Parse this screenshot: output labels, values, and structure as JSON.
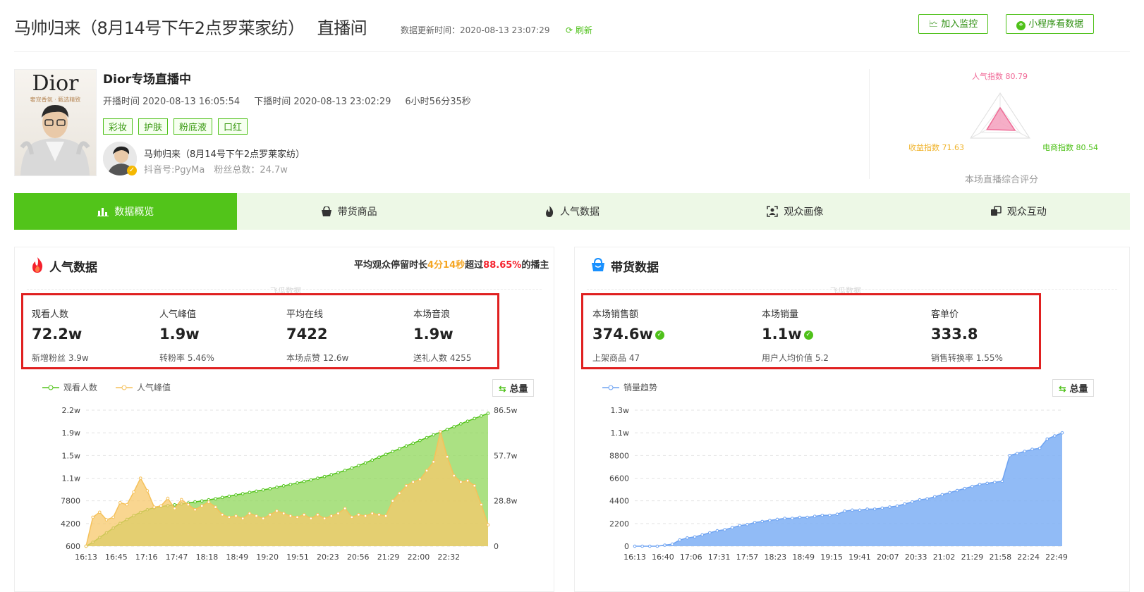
{
  "header": {
    "title": "马帅归来（8月14号下午2点罗莱家纺）",
    "subtitle": "直播间",
    "update_time": "数据更新时间：2020-08-13 23:07:29",
    "refresh": "刷新",
    "monitor_btn": "加入监控",
    "miniapp_btn": "小程序看数据"
  },
  "room": {
    "cover_text": "Dior",
    "cover_tagline": "奢宠香氛 · 甄选精致",
    "title": "Dior专场直播中",
    "start": "开播时间 2020-08-13 16:05:54",
    "end": "下播时间 2020-08-13 23:02:29",
    "duration": "6小时56分35秒",
    "tags": [
      "彩妆",
      "护肤",
      "粉底液",
      "口红"
    ],
    "anchor_name": "马帅归来（8月14号下午2点罗莱家纺）",
    "anchor_meta": "抖音号:PgyMa　粉丝总数：24.7w"
  },
  "radar": {
    "popularity": "人气指数 80.79",
    "revenue": "收益指数 71.63",
    "ecommerce": "电商指数 80.54",
    "caption": "本场直播综合评分",
    "values": [
      80.79,
      80.54,
      71.63
    ]
  },
  "tabs": [
    {
      "label": "数据概览",
      "icon": "bar-chart-icon"
    },
    {
      "label": "带货商品",
      "icon": "shopping-bag-icon"
    },
    {
      "label": "人气数据",
      "icon": "flame-icon"
    },
    {
      "label": "观众画像",
      "icon": "portrait-icon"
    },
    {
      "label": "观众互动",
      "icon": "interaction-icon"
    }
  ],
  "popularity": {
    "title": "人气数据",
    "stay_pre": "平均观众停留时长",
    "stay_time": "4分14秒",
    "stay_mid": "超过",
    "stay_pct": "88.65%",
    "stay_post": "的播主",
    "watermark": "飞瓜数据",
    "metrics": [
      {
        "label": "观看人数",
        "value": "72.2w",
        "sub": "新增粉丝 3.9w"
      },
      {
        "label": "人气峰值",
        "value": "1.9w",
        "sub": "转粉率 5.46%"
      },
      {
        "label": "平均在线",
        "value": "7422",
        "sub": "本场点赞 12.6w"
      },
      {
        "label": "本场音浪",
        "value": "1.9w",
        "sub": "送礼人数 4255"
      }
    ],
    "legend": [
      "观看人数",
      "人气峰值"
    ],
    "total_btn": "总量"
  },
  "sales": {
    "title": "带货数据",
    "watermark": "飞瓜数据",
    "metrics": [
      {
        "label": "本场销售额",
        "value": "374.6w",
        "sub": "上架商品 47",
        "verified": true
      },
      {
        "label": "本场销量",
        "value": "1.1w",
        "sub": "用户人均价值 5.2",
        "verified": true
      },
      {
        "label": "客单价",
        "value": "333.8",
        "sub": "销售转换率 1.55%",
        "verified": false
      }
    ],
    "legend": [
      "销量趋势"
    ],
    "total_btn": "总量"
  },
  "chart_data": [
    {
      "type": "area",
      "x": [
        "16:13",
        "16:45",
        "17:16",
        "17:47",
        "18:18",
        "18:49",
        "19:20",
        "19:51",
        "20:23",
        "20:56",
        "21:29",
        "22:00",
        "22:32"
      ],
      "left_ticks": [
        "600",
        "4200",
        "7800",
        "1.1w",
        "1.5w",
        "1.9w",
        "2.2w"
      ],
      "left_tick_values": [
        600,
        4200,
        7800,
        11400,
        15000,
        18600,
        22200
      ],
      "right_ticks": [
        "0",
        "28.8w",
        "57.7w",
        "86.5w"
      ],
      "right_tick_values": [
        0,
        288000,
        577000,
        865000
      ],
      "series": [
        {
          "name": "观看人数",
          "axis": "right",
          "color": "#52c41a",
          "values": [
            0,
            25000,
            55000,
            85000,
            115000,
            145000,
            170000,
            195000,
            215000,
            232000,
            245000,
            252000,
            258000,
            263000,
            268000,
            275000,
            282000,
            288000,
            295000,
            302000,
            310000,
            318000,
            326000,
            334000,
            342000,
            350000,
            358000,
            366000,
            375000,
            384000,
            393000,
            402000,
            412000,
            422000,
            432000,
            443000,
            455000,
            468000,
            482000,
            497000,
            513000,
            530000,
            548000,
            566000,
            584000,
            602000,
            620000,
            638000,
            655000,
            672000,
            690000,
            708000,
            725000,
            743000,
            760000,
            778000,
            795000,
            812000,
            828000,
            845000
          ]
        },
        {
          "name": "人气峰值",
          "axis": "left",
          "color": "#f5c15a",
          "values": [
            600,
            5200,
            6000,
            4800,
            5200,
            7500,
            7200,
            9200,
            11400,
            9400,
            6800,
            7000,
            8200,
            6600,
            8000,
            7200,
            6400,
            7000,
            7600,
            6800,
            5600,
            5200,
            5400,
            5000,
            5800,
            5400,
            5000,
            5600,
            6200,
            5800,
            5400,
            5200,
            5600,
            5000,
            5600,
            5000,
            5400,
            5800,
            6600,
            5200,
            5600,
            5400,
            5800,
            5600,
            5400,
            7800,
            9000,
            10200,
            10800,
            11200,
            12600,
            14000,
            18800,
            14800,
            11800,
            10800,
            11000,
            10200,
            7200,
            4000
          ]
        }
      ]
    },
    {
      "type": "area",
      "x": [
        "16:13",
        "16:40",
        "17:06",
        "17:31",
        "17:57",
        "18:23",
        "18:49",
        "19:15",
        "19:41",
        "20:07",
        "20:33",
        "21:02",
        "21:29",
        "21:58",
        "22:24",
        "22:49"
      ],
      "y_ticks": [
        "0",
        "2200",
        "4400",
        "6600",
        "8800",
        "1.1w",
        "1.3w"
      ],
      "y_tick_values": [
        0,
        2200,
        4400,
        6600,
        8800,
        11000,
        13200
      ],
      "series": [
        {
          "name": "销量趋势",
          "color": "#6ea3f2",
          "values": [
            0,
            0,
            0,
            0,
            100,
            200,
            600,
            800,
            900,
            1100,
            1300,
            1500,
            1600,
            1800,
            2000,
            2100,
            2300,
            2400,
            2500,
            2600,
            2700,
            2700,
            2800,
            2800,
            2900,
            3000,
            3000,
            3100,
            3400,
            3500,
            3500,
            3600,
            3600,
            3700,
            3800,
            3900,
            4100,
            4300,
            4500,
            4600,
            4800,
            5000,
            5200,
            5400,
            5600,
            5800,
            6000,
            6100,
            6200,
            6300,
            8800,
            9000,
            9200,
            9400,
            9500,
            10400,
            10700,
            11000
          ]
        }
      ]
    }
  ]
}
